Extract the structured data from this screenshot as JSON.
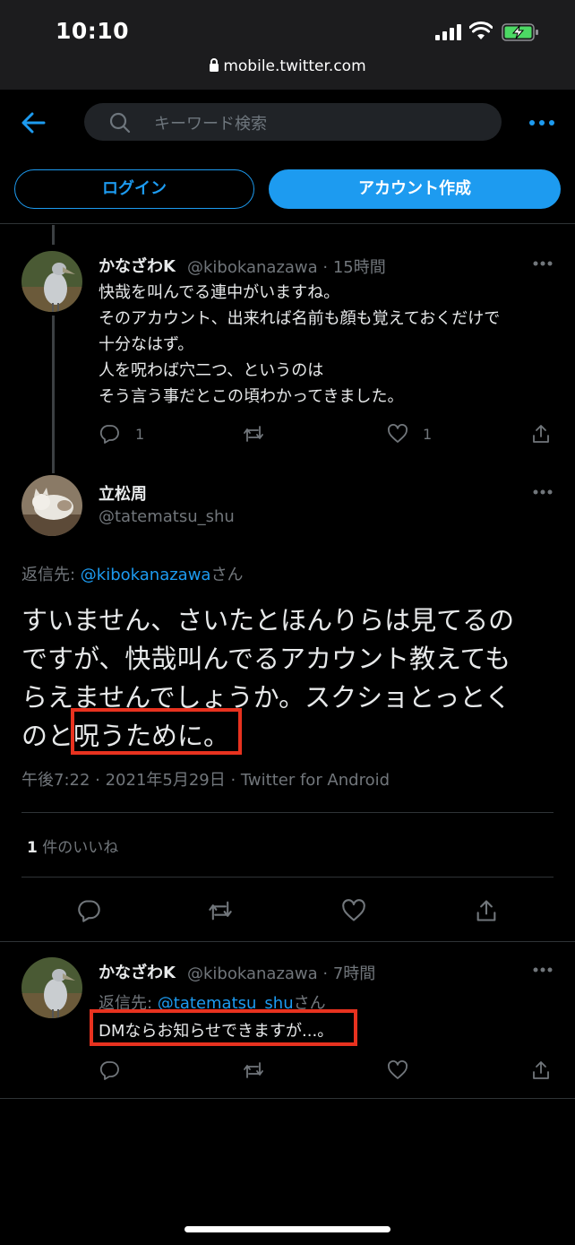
{
  "status_bar": {
    "time": "10:10",
    "url": "mobile.twitter.com"
  },
  "header": {
    "search_placeholder": "キーワード検索",
    "login_label": "ログイン",
    "signup_label": "アカウント作成"
  },
  "tweets": [
    {
      "name": "かなざわK",
      "handle": "@kibokanazawa",
      "time": "15時間",
      "lines": [
        "快哉を叫んでる連中がいますね。",
        "そのアカウント、出来れば名前も顔も覚えておくだけで",
        "十分なはず。",
        "人を呪わば穴二つ、というのは",
        "そう言う事だとこの頃わかってきました。"
      ],
      "reply_count": "1",
      "like_count": "1"
    }
  ],
  "main_tweet": {
    "name": "立松周",
    "handle": "@tatematsu_shu",
    "reply_prefix": "返信先: ",
    "reply_mention": "@kibokanazawa",
    "reply_suffix": "さん",
    "text_lines": [
      "すいません、さいたとほんりらは見てるの",
      "ですが、快哉叫んでるアカウント教えても",
      "らえませんでしょうか。スクショとっとく",
      "のと呪うために。"
    ],
    "meta": "午後7:22 · 2021年5月29日 · Twitter for Android",
    "likes_count": "1",
    "likes_label": " 件のいいね"
  },
  "reply_tweet": {
    "name": "かなざわK",
    "handle": "@kibokanazawa",
    "time": "7時間",
    "reply_prefix": "返信先: ",
    "reply_mention": "@tatematsu_shu",
    "reply_suffix": "さん",
    "text": "DMならお知らせできますが...。"
  },
  "colors": {
    "accent": "#1d9bf0",
    "highlight_box": "#e8321f",
    "background": "#000000"
  }
}
